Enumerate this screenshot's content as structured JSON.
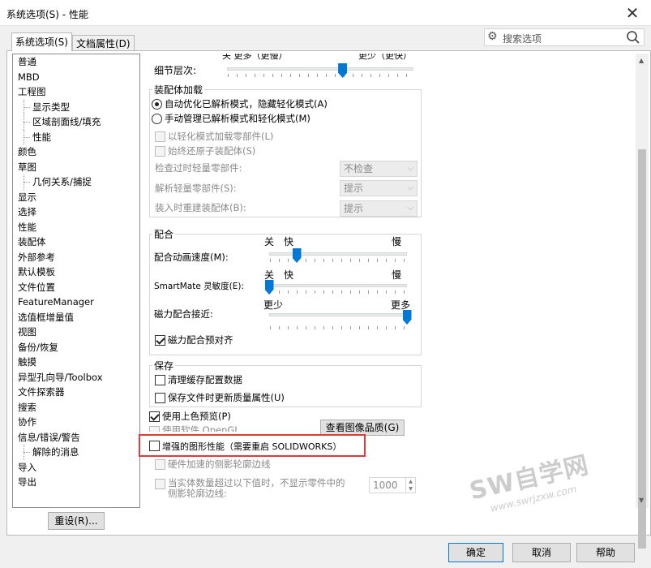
{
  "window": {
    "title": "系统选项(S) - 性能",
    "close_glyph": "✕"
  },
  "tabs": [
    {
      "label": "系统选项(S)",
      "active": true
    },
    {
      "label": "文档属性(D)",
      "active": false
    }
  ],
  "search": {
    "placeholder": "搜索选项"
  },
  "tree": [
    {
      "label": "普通",
      "level": 0
    },
    {
      "label": "MBD",
      "level": 0
    },
    {
      "label": "工程图",
      "level": 0
    },
    {
      "label": "显示类型",
      "level": 1
    },
    {
      "label": "区域剖面线/填充",
      "level": 1
    },
    {
      "label": "性能",
      "level": 1
    },
    {
      "label": "颜色",
      "level": 0
    },
    {
      "label": "草图",
      "level": 0
    },
    {
      "label": "几何关系/捕捉",
      "level": 1
    },
    {
      "label": "显示",
      "level": 0
    },
    {
      "label": "选择",
      "level": 0
    },
    {
      "label": "性能",
      "level": 0
    },
    {
      "label": "装配体",
      "level": 0
    },
    {
      "label": "外部参考",
      "level": 0
    },
    {
      "label": "默认模板",
      "level": 0
    },
    {
      "label": "文件位置",
      "level": 0
    },
    {
      "label": "FeatureManager",
      "level": 0
    },
    {
      "label": "选值框增量值",
      "level": 0
    },
    {
      "label": "视图",
      "level": 0
    },
    {
      "label": "备份/恢复",
      "level": 0
    },
    {
      "label": "触摸",
      "level": 0
    },
    {
      "label": "异型孔向导/Toolbox",
      "level": 0
    },
    {
      "label": "文件探索器",
      "level": 0
    },
    {
      "label": "搜索",
      "level": 0
    },
    {
      "label": "协作",
      "level": 0
    },
    {
      "label": "信息/错误/警告",
      "level": 0
    },
    {
      "label": "解除的消息",
      "level": 1
    },
    {
      "label": "导入",
      "level": 0
    },
    {
      "label": "导出",
      "level": 0
    }
  ],
  "reset_label": "重设(R)...",
  "detail": {
    "top_cut_labels": "关 更多（更慢）",
    "top_cut_right": "更少（更快）",
    "label": "细节层次:",
    "value": 0.62
  },
  "assembly_load": {
    "title": "装配体加载",
    "radio_auto": "自动优化已解析模式，隐藏轻化模式(A)",
    "radio_manual": "手动管理已解析模式和轻化模式(M)",
    "chk_load_light": "以轻化模式加载零部件(L)",
    "chk_always_restore": "始终还原子装配体(S)",
    "check_outdated_label": "检查过时轻量零部件:",
    "check_outdated_value": "不检查",
    "resolve_label": "解析轻量零部件(S):",
    "resolve_value": "提示",
    "rebuild_label": "装入时重建装配体(B):",
    "rebuild_value": "提示"
  },
  "mate": {
    "title": "配合",
    "anim_off": "关",
    "anim_fast": "快",
    "anim_slow": "慢",
    "anim_label": "配合动画速度(M):",
    "anim_value": 0.2,
    "sm_off": "关",
    "sm_fast": "快",
    "sm_slow": "慢",
    "sm_label": "SmartMate 灵敏度(E):",
    "sm_value": 0.0,
    "magnet_less": "更少",
    "magnet_more": "更多",
    "magnet_label": "磁力配合接近:",
    "magnet_value": 1.0,
    "chk_magnet_prealign": "磁力配合预对齐"
  },
  "save": {
    "title": "保存",
    "chk_purge": "清理缓存配置数据",
    "chk_update_mass": "保存文件时更新质量属性(U)"
  },
  "shaded_preview": "使用上色预览(P)",
  "use_software_opengl": "使用软件 OpenGL",
  "view_quality_button": "查看图像品质(G)",
  "enhanced_graphics": "增强的图形性能（需要重启 SOLIDWORKS）",
  "hw_silhouette": "硬件加速的侧影轮廓边线",
  "hide_silhouette_line1": "当实体数量超过以下值时，不显示零件中的",
  "hide_silhouette_line2": "侧影轮廓边线:",
  "hide_silhouette_value": "1000",
  "watermark": {
    "big": "SW自学网",
    "small": "www.swrjzxw.com"
  },
  "buttons": {
    "ok": "确定",
    "cancel": "取消",
    "help": "帮助"
  },
  "colors": {
    "accent": "#0078d7",
    "highlight_box": "#e03a3a"
  }
}
